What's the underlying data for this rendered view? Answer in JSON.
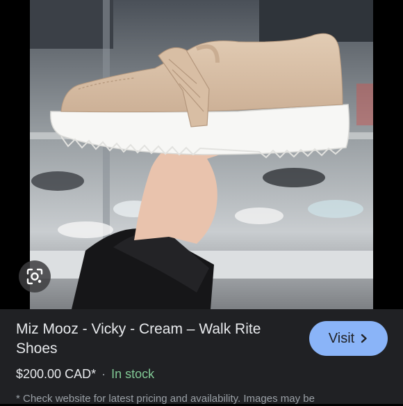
{
  "image": {
    "alt_subject": "shoe-photo"
  },
  "lens": {
    "icon": "lens-camera-icon"
  },
  "product": {
    "title": "Miz Mooz - Vicky - Cream – Walk Rite Shoes",
    "price": "$200.00 CAD*",
    "separator": "·",
    "availability": "In stock",
    "disclaimer": "* Check website for latest pricing and availability. Images may be"
  },
  "actions": {
    "visit_label": "Visit",
    "visit_icon": "chevron-right-icon"
  },
  "colors": {
    "panel_bg": "#202124",
    "visit_button_bg": "#8ab4f8",
    "stock_green": "#81c995",
    "text_primary": "#e8eaed",
    "text_secondary": "#9aa0a6"
  }
}
